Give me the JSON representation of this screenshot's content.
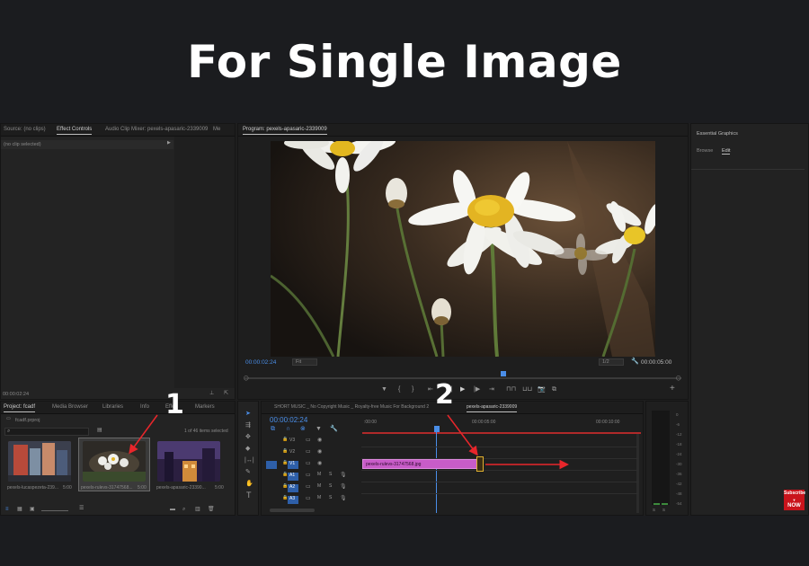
{
  "headline": "For Single Image",
  "source_panel": {
    "tabs": [
      "Source: (no clips)",
      "Effect Controls",
      "Audio Clip Mixer: pexels-apasaric-2339009",
      "Me"
    ],
    "no_clip": "(no clip selected)",
    "timecode": "00:00:02:24"
  },
  "program_panel": {
    "tab": "Program: pexels-apasaric-2339009",
    "timecode": "00:00:02:24",
    "fit": "Fit",
    "scale": "1/2",
    "duration": "00:00:05:00"
  },
  "essential_graphics": {
    "title": "Essential Graphics",
    "tabs": [
      "Browse",
      "Edit"
    ]
  },
  "project_panel": {
    "tabs": [
      "Project: fcadf",
      "Media Browser",
      "Libraries",
      "Info",
      "Effe",
      "Markers"
    ],
    "project_file": "fcadf.prproj",
    "selection": "1 of 46 items selected",
    "items": [
      {
        "name": "pexels-lucaspezeta-239...",
        "duration": "5:00"
      },
      {
        "name": "pexels-rulevs-31747568...",
        "duration": "5:00"
      },
      {
        "name": "pexels-apasaric-23390...",
        "duration": "5:00"
      }
    ]
  },
  "timeline": {
    "tabs": [
      "SHORT MUSIC _ No Copyright Music _ Royalty-free Music For Background 2",
      "pexels-apasaric-2339009"
    ],
    "timecode": "00:00:02:24",
    "ruler": [
      ":00:00",
      "00:00:05:00",
      "00:00:10:00"
    ],
    "tracks": [
      "V3",
      "V2",
      "V1",
      "A1",
      "A2",
      "A3"
    ],
    "clip_name": "pexels-rulevs-31747568.jpg"
  },
  "meter": {
    "ticks": [
      "0",
      "-6",
      "-12",
      "-18",
      "-24",
      "-30",
      "-36",
      "-42",
      "-48",
      "-54"
    ],
    "channels": [
      "S",
      "S"
    ]
  },
  "annotations": {
    "marker1": "1",
    "marker2": "2"
  },
  "subscribe": {
    "line1": "Subscribe",
    "line2": "NOW"
  },
  "colors": {
    "accent_blue": "#4a8ee8",
    "clip_pink": "#c85cc8",
    "arrow_red": "#e8262b",
    "playhead": "#4a8ee8"
  }
}
